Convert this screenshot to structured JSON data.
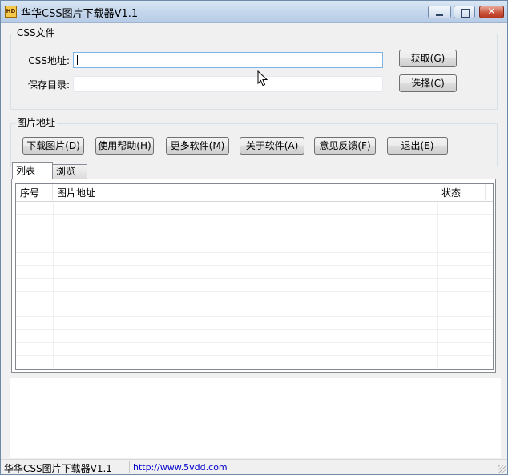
{
  "window": {
    "title": "华华CSS图片下载器V1.1"
  },
  "css_group": {
    "label": "CSS文件",
    "css_address_label": "CSS地址:",
    "css_address_value": "",
    "save_dir_label": "保存目录:",
    "save_dir_value": "",
    "fetch_button": "获取(G)",
    "select_button": "选择(C)"
  },
  "image_group": {
    "label": "图片地址",
    "buttons": {
      "download": "下载图片(D)",
      "help": "使用帮助(H)",
      "more": "更多软件(M)",
      "about": "关于软件(A)",
      "feedback": "意见反馈(F)",
      "exit": "退出(E)"
    }
  },
  "tabs": [
    {
      "label": "列表",
      "active": true
    },
    {
      "label": "浏览",
      "active": false
    }
  ],
  "grid": {
    "columns": [
      "序号",
      "图片地址",
      "状态"
    ],
    "rows": []
  },
  "statusbar": {
    "title": "华华CSS图片下载器V1.1",
    "url": "http://www.5vdd.com"
  },
  "colors": {
    "window_bg": "#f0f0f0",
    "link": "#0000cc",
    "close_button": "#c75037"
  }
}
